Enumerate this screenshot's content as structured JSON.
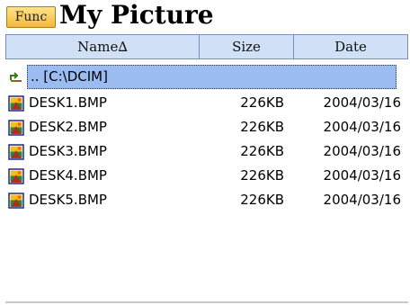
{
  "titlebar": {
    "func_label": "Func",
    "title": "My Picture"
  },
  "columns": {
    "name": "Name∆",
    "size": "Size",
    "date": "Date"
  },
  "parent_row": {
    "label": ".. [C:\\DCIM]",
    "icon": "folder-up-icon"
  },
  "files": [
    {
      "name": "DESK1.BMP",
      "size": "226KB",
      "date": "2004/03/16",
      "icon": "bitmap-file-icon"
    },
    {
      "name": "DESK2.BMP",
      "size": "226KB",
      "date": "2004/03/16",
      "icon": "bitmap-file-icon"
    },
    {
      "name": "DESK3.BMP",
      "size": "226KB",
      "date": "2004/03/16",
      "icon": "bitmap-file-icon"
    },
    {
      "name": "DESK4.BMP",
      "size": "226KB",
      "date": "2004/03/16",
      "icon": "bitmap-file-icon"
    },
    {
      "name": "DESK5.BMP",
      "size": "226KB",
      "date": "2004/03/16",
      "icon": "bitmap-file-icon"
    }
  ],
  "colors": {
    "header_bg": "#cfe0f7",
    "selection_bg": "#9bbcf0",
    "func_button": "#f4b83a"
  }
}
